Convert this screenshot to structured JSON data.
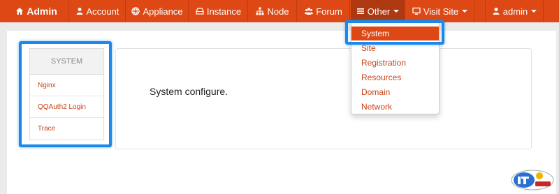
{
  "navbar": {
    "brand": "Admin",
    "items": [
      {
        "label": "Account",
        "icon": "user-icon"
      },
      {
        "label": "Appliance",
        "icon": "globe-icon"
      },
      {
        "label": "Instance",
        "icon": "hdd-icon"
      },
      {
        "label": "Node",
        "icon": "sitemap-icon"
      },
      {
        "label": "Forum",
        "icon": "group-icon"
      },
      {
        "label": "Other",
        "icon": "list-icon",
        "active": true
      },
      {
        "label": "Visit Site",
        "icon": "desktop-icon"
      },
      {
        "label": "admin",
        "icon": "user-icon"
      }
    ],
    "color": "#dd4814"
  },
  "dropdown": {
    "items": [
      "System",
      "Site",
      "Registration",
      "Resources",
      "Domain",
      "Network"
    ],
    "selected": "System"
  },
  "sidebar": {
    "heading": "SYSTEM",
    "items": [
      "Nginx",
      "QQAuth2 Login",
      "Trace"
    ]
  },
  "content": {
    "text": "System configure."
  },
  "annotation_color": "#1e88ea"
}
